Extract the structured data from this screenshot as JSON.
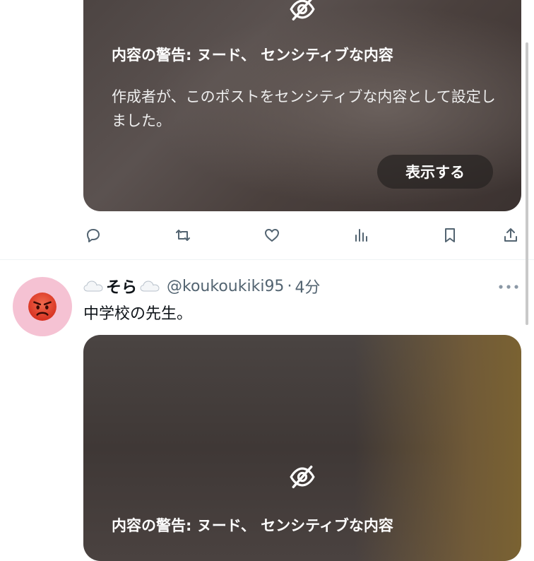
{
  "post1": {
    "media": {
      "warning_title": "内容の警告: ヌード、 センシティブな内容",
      "warning_body": "作成者が、このポストをセンシティブな内容として設定しました。",
      "show_label": "表示する"
    },
    "actions": [
      "reply",
      "repost",
      "like",
      "views",
      "bookmark",
      "share"
    ]
  },
  "post2": {
    "avatar_icon": "angry-face-emoji",
    "display_name": "そら",
    "name_icons": [
      "cloud-emoji",
      "cloud-emoji"
    ],
    "handle": "@koukoukiki95",
    "separator": "·",
    "time": "4分",
    "text": "中学校の先生。",
    "media": {
      "warning_title": "内容の警告: ヌード、 センシティブな内容"
    }
  },
  "colors": {
    "text_primary": "#0f1419",
    "text_secondary": "#536471",
    "avatar_bg": "#f5c2d3",
    "divider": "#eff3f4"
  }
}
